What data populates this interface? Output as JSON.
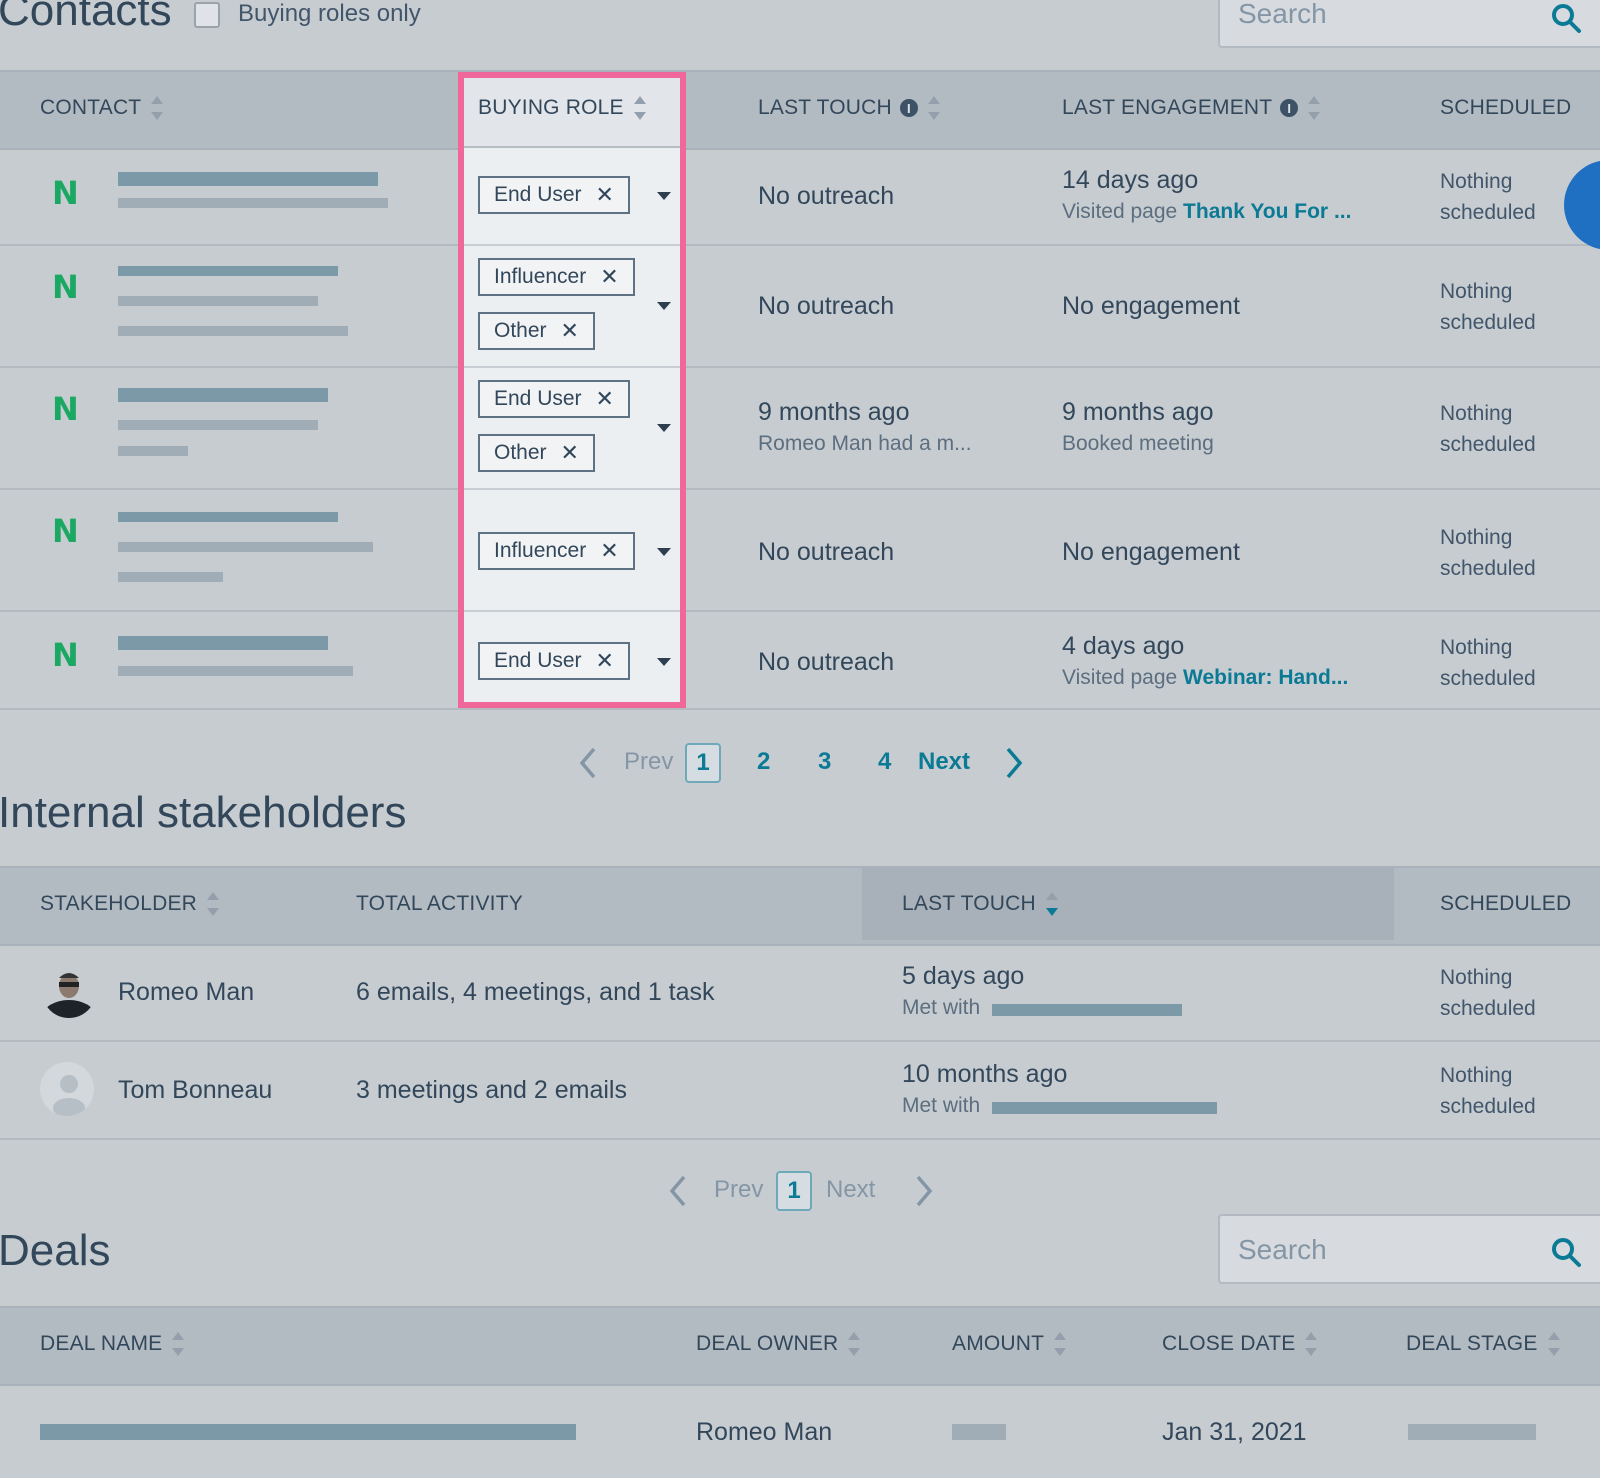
{
  "contacts": {
    "title": "Contacts",
    "filter_label": "Buying roles only",
    "search_placeholder": "Search",
    "columns": {
      "contact": "CONTACT",
      "buying_role": "BUYING ROLE",
      "last_touch": "LAST TOUCH",
      "last_engagement": "LAST ENGAGEMENT",
      "scheduled": "SCHEDULED"
    },
    "rows": [
      {
        "logo": "N",
        "roles": [
          "End User"
        ],
        "last_touch": "No outreach",
        "last_touch_sub": "",
        "engagement": "14 days ago",
        "engagement_sub_prefix": "Visited page",
        "engagement_sub_link": "Thank You For ...",
        "sched1": "Nothing",
        "sched2": "scheduled"
      },
      {
        "logo": "N",
        "roles": [
          "Influencer",
          "Other"
        ],
        "last_touch": "No outreach",
        "last_touch_sub": "",
        "engagement": "No engagement",
        "engagement_sub_prefix": "",
        "engagement_sub_link": "",
        "sched1": "Nothing",
        "sched2": "scheduled"
      },
      {
        "logo": "N",
        "roles": [
          "End User",
          "Other"
        ],
        "last_touch": "9 months ago",
        "last_touch_sub": "Romeo Man had a m...",
        "engagement": "9 months ago",
        "engagement_sub_prefix": "Booked meeting",
        "engagement_sub_link": "",
        "sched1": "Nothing",
        "sched2": "scheduled"
      },
      {
        "logo": "N",
        "roles": [
          "Influencer"
        ],
        "last_touch": "No outreach",
        "last_touch_sub": "",
        "engagement": "No engagement",
        "engagement_sub_prefix": "",
        "engagement_sub_link": "",
        "sched1": "Nothing",
        "sched2": "scheduled"
      },
      {
        "logo": "N",
        "roles": [
          "End User"
        ],
        "last_touch": "No outreach",
        "last_touch_sub": "",
        "engagement": "4 days ago",
        "engagement_sub_prefix": "Visited page",
        "engagement_sub_link": "Webinar: Hand...",
        "sched1": "Nothing",
        "sched2": "scheduled"
      }
    ],
    "pagination": {
      "prev": "Prev",
      "current": "1",
      "pages": [
        "2",
        "3",
        "4"
      ],
      "next": "Next"
    }
  },
  "stakeholders": {
    "title": "Internal stakeholders",
    "columns": {
      "stakeholder": "STAKEHOLDER",
      "total_activity": "TOTAL ACTIVITY",
      "last_touch": "LAST TOUCH",
      "scheduled": "SCHEDULED"
    },
    "rows": [
      {
        "name": "Romeo Man",
        "activity": "6 emails, 4 meetings, and 1 task",
        "last_touch": "5 days ago",
        "last_touch_sub": "Met with",
        "sched1": "Nothing",
        "sched2": "scheduled"
      },
      {
        "name": "Tom Bonneau",
        "activity": "3 meetings and 2 emails",
        "last_touch": "10 months ago",
        "last_touch_sub": "Met with",
        "sched1": "Nothing",
        "sched2": "scheduled"
      }
    ],
    "pagination": {
      "prev": "Prev",
      "current": "1",
      "next": "Next"
    }
  },
  "deals": {
    "title": "Deals",
    "search_placeholder": "Search",
    "columns": {
      "deal_name": "DEAL NAME",
      "deal_owner": "DEAL OWNER",
      "amount": "AMOUNT",
      "close_date": "CLOSE DATE",
      "deal_stage": "DEAL STAGE"
    },
    "rows": [
      {
        "owner": "Romeo Man",
        "close_date": "Jan 31, 2021"
      }
    ]
  },
  "colors": {
    "accent": "#0b7a94",
    "highlight_border": "#f0679a",
    "logo_green": "#1ba863",
    "background": "#c7ccd1"
  },
  "icons": [
    "search-icon",
    "info-icon",
    "sort-icon",
    "close-icon",
    "caret-down-icon",
    "chevron-left-icon",
    "chevron-right-icon"
  ]
}
